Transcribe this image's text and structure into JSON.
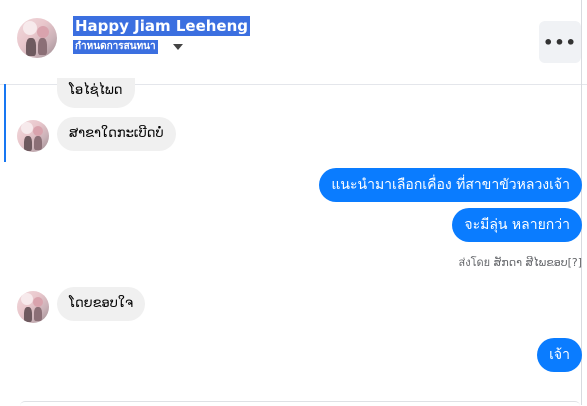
{
  "header": {
    "title": "Happy Jiam Leeheng",
    "subtitle": "กำหนดการสนทนา",
    "more_label": "•••"
  },
  "messages": [
    {
      "side": "in",
      "text": "ໂອໄຊ່ໄພດ"
    },
    {
      "side": "in",
      "text": "ສາຂາໃດກະເບີດບໍ່"
    },
    {
      "side": "out",
      "text": "แนะนำมาเลือกเคื่อง ที่สาขาขัวหลวงเจ้า"
    },
    {
      "side": "out",
      "text": "จะมีลุ่น หลายกว่า"
    },
    {
      "side": "in",
      "text": "ໂດຍຂອບໃຈ"
    },
    {
      "side": "out",
      "text": "เจ้า"
    }
  ],
  "sent_by": "ส่งโดย ສັກດາ ສີໄພຂອບ",
  "sent_by_help": "[?]",
  "colors": {
    "accent": "#0a7cff",
    "incoming_bubble": "#f0f0f0",
    "header_highlight": "#3b6fe0"
  }
}
